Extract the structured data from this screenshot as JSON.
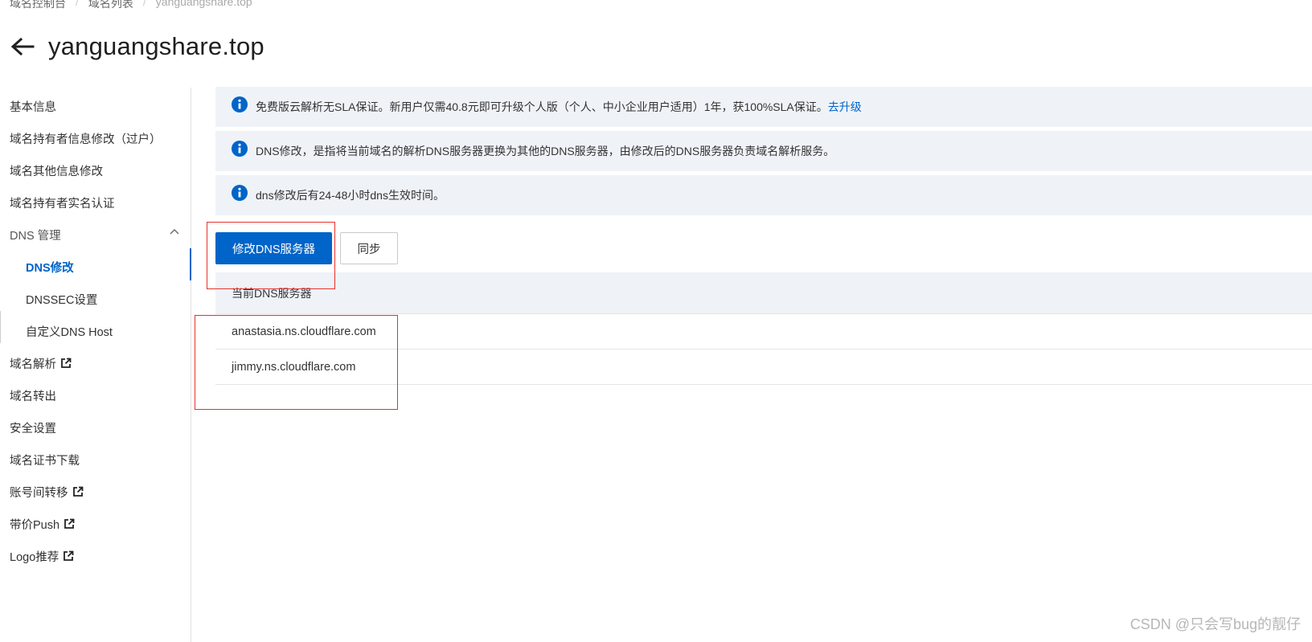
{
  "breadcrumb": {
    "items": [
      "域名控制台",
      "域名列表",
      "yanguangshare.top"
    ]
  },
  "header": {
    "title": "yanguangshare.top"
  },
  "sidebar": {
    "items": [
      {
        "label": "基本信息"
      },
      {
        "label": "域名持有者信息修改（过户）"
      },
      {
        "label": "域名其他信息修改"
      },
      {
        "label": "域名持有者实名认证"
      },
      {
        "label": "DNS 管理"
      },
      {
        "label": "DNS修改"
      },
      {
        "label": "DNSSEC设置"
      },
      {
        "label": "自定义DNS Host"
      },
      {
        "label": "域名解析"
      },
      {
        "label": "域名转出"
      },
      {
        "label": "安全设置"
      },
      {
        "label": "域名证书下载"
      },
      {
        "label": "账号间转移"
      },
      {
        "label": "带价Push"
      },
      {
        "label": "Logo推荐"
      }
    ]
  },
  "alerts": [
    {
      "text": "免费版云解析无SLA保证。新用户仅需40.8元即可升级个人版（个人、中小企业用户适用）1年，获100%SLA保证。",
      "link": "去升级"
    },
    {
      "text": "DNS修改，是指将当前域名的解析DNS服务器更换为其他的DNS服务器，由修改后的DNS服务器负责域名解析服务。"
    },
    {
      "text": "dns修改后有24-48小时dns生效时间。"
    }
  ],
  "buttons": {
    "modify": "修改DNS服务器",
    "sync": "同步"
  },
  "table": {
    "header": "当前DNS服务器",
    "rows": [
      "anastasia.ns.cloudflare.com",
      "jimmy.ns.cloudflare.com"
    ]
  },
  "watermark": "CSDN @只会写bug的靓仔",
  "colors": {
    "accent": "#0064c8",
    "alert_bg": "#eff3f8",
    "annotation": "#e8302c"
  }
}
